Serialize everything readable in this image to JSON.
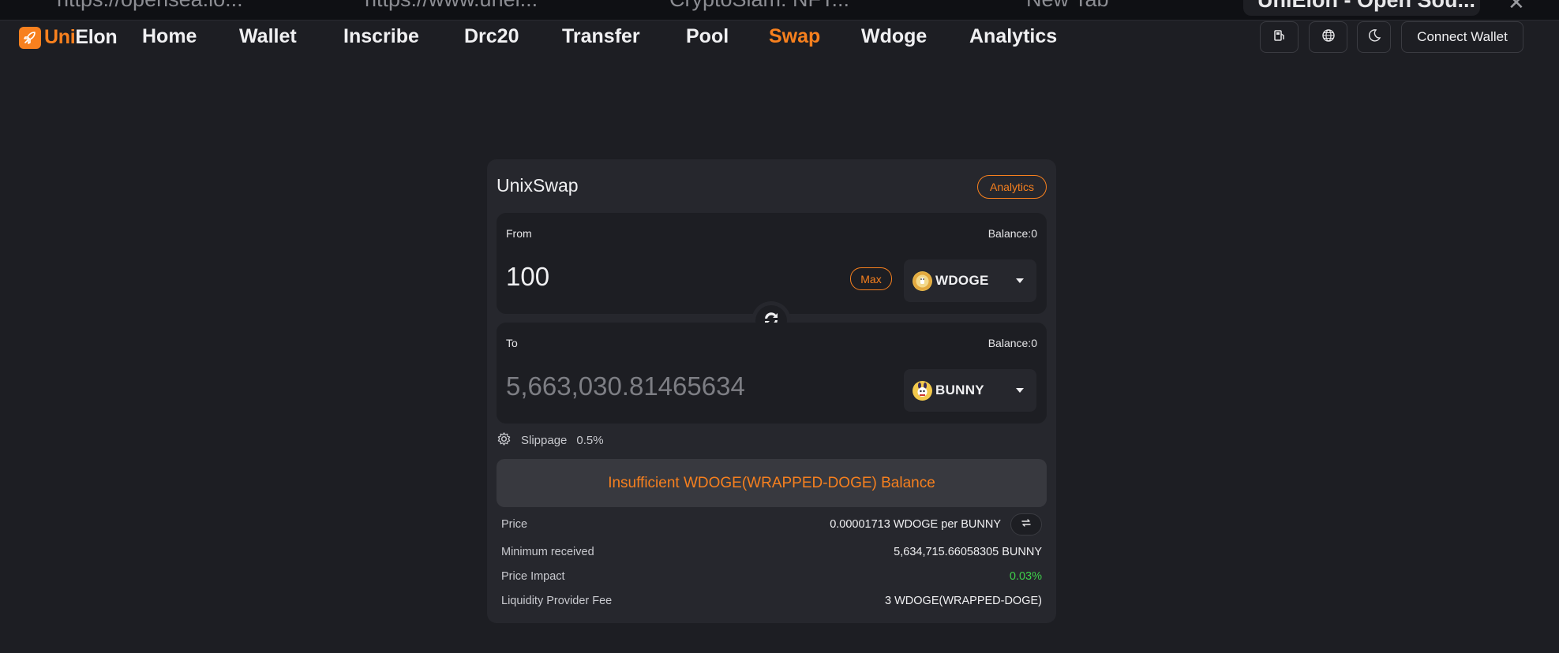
{
  "browser_tabs": [
    {
      "title": "https://opensea.io..."
    },
    {
      "title": "https://www.unel..."
    },
    {
      "title": "CryptoSlam: NFT..."
    },
    {
      "title": "New Tab"
    },
    {
      "title": "UniElon - Open Sou..."
    }
  ],
  "brand": {
    "uni": "Uni",
    "elon": "Elon",
    "accent": "#f7801e"
  },
  "nav": {
    "items": [
      "Home",
      "Wallet",
      "Inscribe",
      "Drc20",
      "Transfer",
      "Pool",
      "Swap",
      "Wdoge",
      "Analytics"
    ],
    "active": "Swap"
  },
  "header_actions": {
    "icons": [
      "gas-pump-icon",
      "globe-icon",
      "moon-icon"
    ],
    "connect_label": "Connect Wallet"
  },
  "swap": {
    "title": "UnixSwap",
    "analytics_label": "Analytics",
    "from": {
      "label": "From",
      "balance": "Balance:0",
      "amount": "100",
      "max_label": "Max",
      "token": "WDOGE",
      "token_icon": "doge-coin-icon"
    },
    "to": {
      "label": "To",
      "balance": "Balance:0",
      "amount": "5,663,030.81465634",
      "token": "BUNNY",
      "token_icon": "bunny-token-icon"
    },
    "slippage": {
      "label": "Slippage",
      "value": "0.5%"
    },
    "action_label": "Insufficient WDOGE(WRAPPED-DOGE) Balance",
    "details": {
      "price_label": "Price",
      "price_value": "0.00001713 WDOGE per BUNNY",
      "min_received_label": "Minimum received",
      "min_received_value": "5,634,715.66058305 BUNNY",
      "price_impact_label": "Price Impact",
      "price_impact_value": "0.03%",
      "price_impact_color": "#3ecf4a",
      "fee_label": "Liquidity Provider Fee",
      "fee_value": "3 WDOGE(WRAPPED-DOGE)"
    }
  }
}
